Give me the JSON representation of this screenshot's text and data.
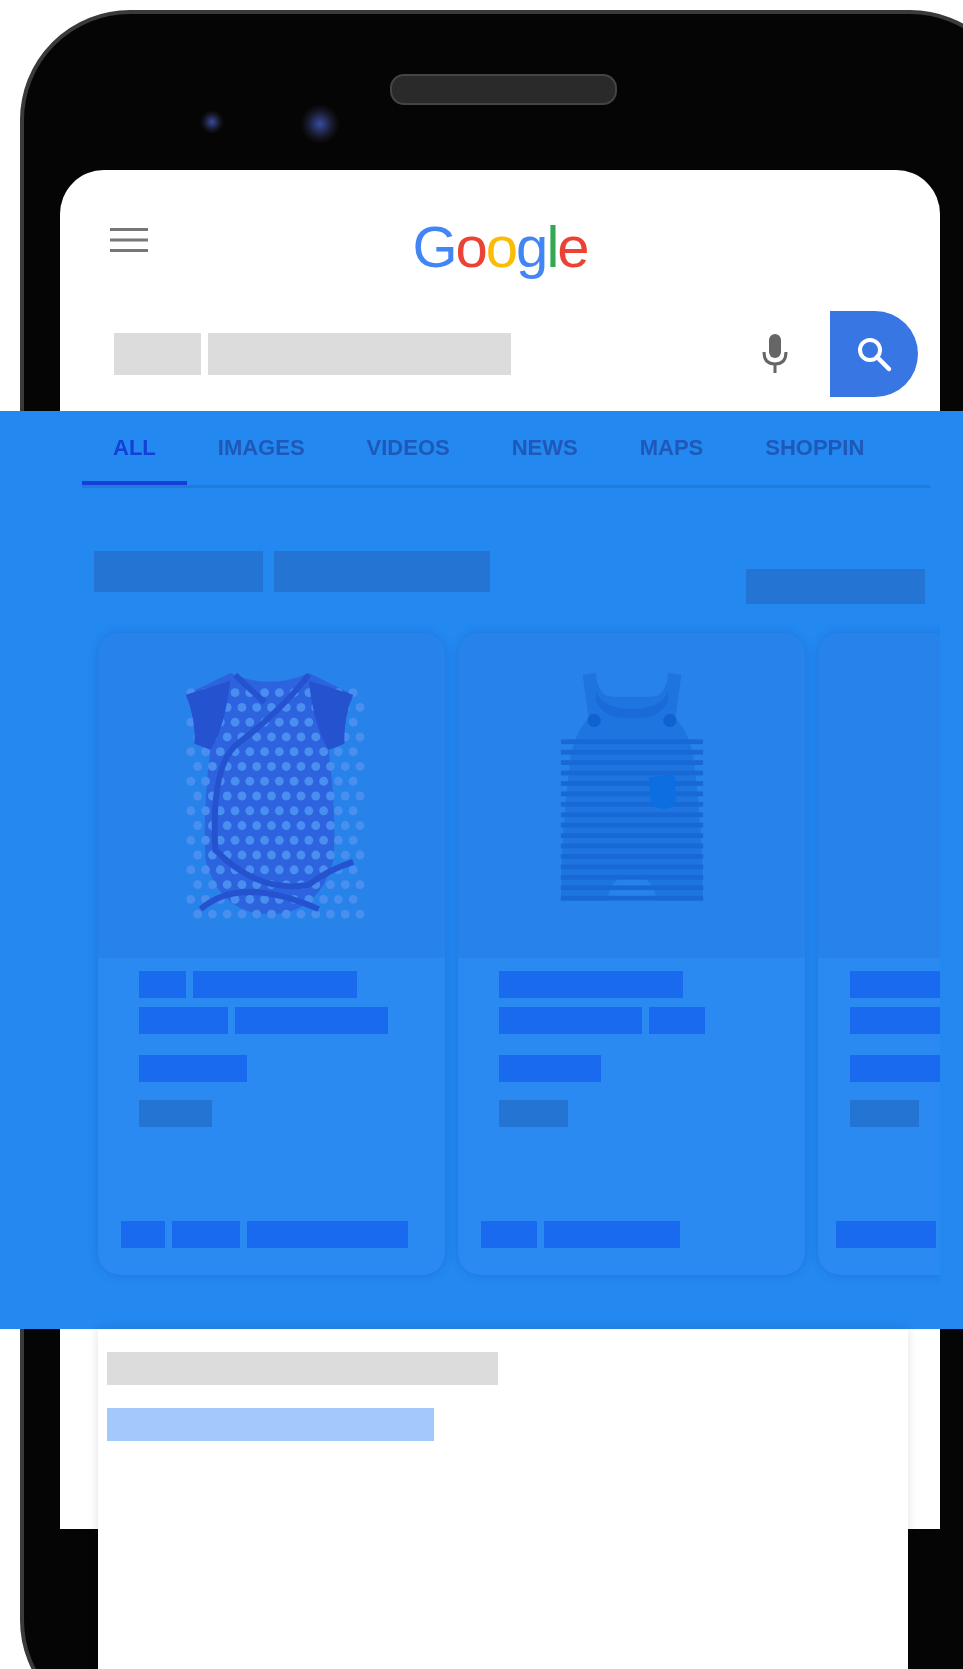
{
  "header": {
    "logo": "Google"
  },
  "tabs": [
    {
      "label": "ALL",
      "selected": true
    },
    {
      "label": "IMAGES",
      "selected": false
    },
    {
      "label": "VIDEOS",
      "selected": false
    },
    {
      "label": "NEWS",
      "selected": false
    },
    {
      "label": "MAPS",
      "selected": false
    },
    {
      "label": "SHOPPIN",
      "selected": false
    }
  ]
}
